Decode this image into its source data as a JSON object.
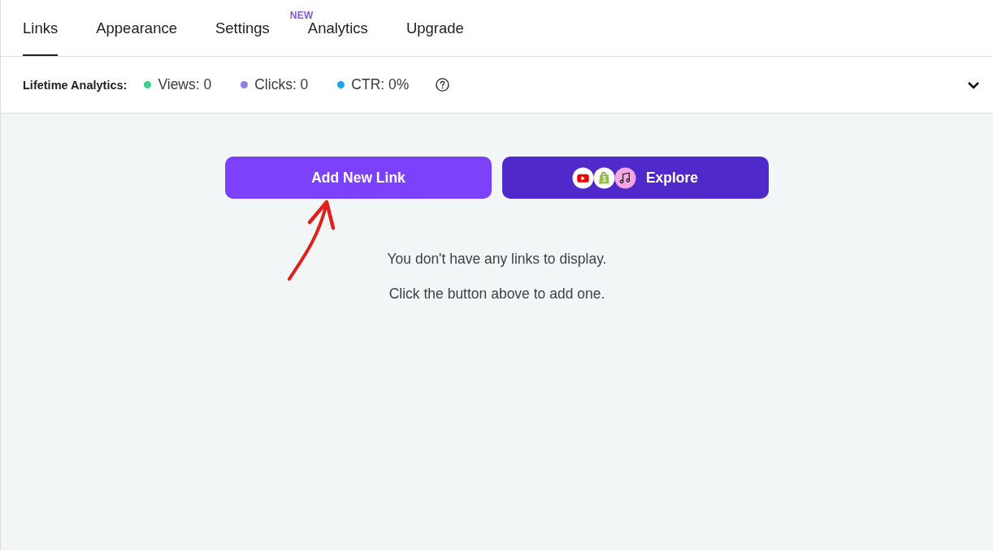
{
  "tabs": [
    {
      "label": "Links",
      "selected": true
    },
    {
      "label": "Appearance",
      "selected": false
    },
    {
      "label": "Settings",
      "selected": false
    },
    {
      "label": "Analytics",
      "selected": false,
      "badge": "NEW"
    },
    {
      "label": "Upgrade",
      "selected": false
    }
  ],
  "analytics_bar": {
    "title": "Lifetime Analytics:",
    "stats": [
      {
        "label": "Views: 0",
        "color": "#3ecf8e"
      },
      {
        "label": "Clicks: 0",
        "color": "#8f7fe6"
      },
      {
        "label": "CTR: 0%",
        "color": "#1aa7ec"
      }
    ],
    "expanded": false
  },
  "actions": [
    {
      "label": "Add New Link",
      "kind": "primary"
    },
    {
      "label": "Explore",
      "kind": "explore"
    }
  ],
  "empty_state": [
    "You don't have any links to display.",
    "Click the button above to add one."
  ]
}
